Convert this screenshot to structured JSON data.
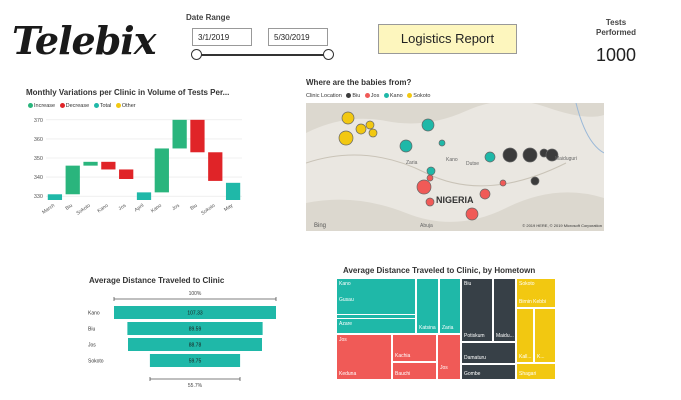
{
  "brand": {
    "logo_text": "Telebix"
  },
  "date_range": {
    "label": "Date Range",
    "start": "3/1/2019",
    "end": "5/30/2019"
  },
  "report_title": "Logistics Report",
  "kpi": {
    "label": "Tests Performed",
    "value": "1000"
  },
  "colors": {
    "increase": "#2ab57d",
    "decrease": "#e02428",
    "total": "#1fb8a8",
    "other": "#f2c811"
  },
  "waterfall": {
    "title": "Monthly Variations per Clinic in Volume of Tests Per...",
    "legend": [
      "Increase",
      "Decrease",
      "Total",
      "Other"
    ],
    "y_ticks": [
      "370",
      "360",
      "350",
      "340",
      "330"
    ]
  },
  "map": {
    "title": "Where are the babies from?",
    "legend_label": "Clinic Location",
    "legend_items": [
      "Biu",
      "Jos",
      "Kano",
      "Sokoto"
    ],
    "country_label": "NIGERIA",
    "attribution": "© 2019 HERE, © 2019 Microsoft Corporation",
    "bing": "Bing",
    "place_labels": [
      "Kano",
      "Dutse",
      "Maiduguri",
      "Abuja",
      "Zaria"
    ]
  },
  "funnel": {
    "title": "Average Distance Traveled to Clinic",
    "top_pct": "100%",
    "bottom_pct": "55.7%"
  },
  "treemap": {
    "title": "Average Distance Traveled to Clinic, by Hometown",
    "cells": {
      "kano_head": "Kano",
      "gusau": "Gusau",
      "azare": "Azare",
      "katsina": "Katsina",
      "zaria": "Zaria",
      "biu_head": "Biu",
      "potiskum": "Potiskum",
      "maidu": "Maidu...",
      "jos_head": "Jos",
      "kachia": "Kachia",
      "keduna": "Keduna",
      "bauchi": "Bauchi",
      "jos_small": "Jos",
      "damaturu": "Damaturu",
      "gombe": "Gombe",
      "sokoto_head": "Sokoto",
      "birnin": "Birnin Kebbi",
      "kall": "Kall...",
      "k": "K...",
      "shagari": "Shagari"
    }
  },
  "chart_data": [
    {
      "type": "bar",
      "subtype": "waterfall",
      "title": "Monthly Variations per Clinic in Volume of Tests Per...",
      "categories": [
        "March",
        "Biu",
        "Sokoto",
        "Kano",
        "Jos",
        "April",
        "Kano",
        "Jos",
        "Biu",
        "Sokoto",
        "May"
      ],
      "series": [
        {
          "name": "Increase",
          "values": [
            null,
            15,
            2,
            null,
            null,
            null,
            23,
            15,
            null,
            null,
            null
          ]
        },
        {
          "name": "Decrease",
          "values": [
            null,
            null,
            null,
            -4,
            -5,
            null,
            null,
            null,
            -17,
            -15,
            null
          ]
        },
        {
          "name": "Total",
          "values": [
            331,
            null,
            null,
            null,
            null,
            332,
            null,
            null,
            null,
            null,
            337
          ]
        }
      ],
      "ylim": [
        328,
        372
      ]
    },
    {
      "type": "bar",
      "subtype": "funnel",
      "title": "Average Distance Traveled to Clinic",
      "categories": [
        "Kano",
        "Biu",
        "Jos",
        "Sokoto"
      ],
      "values": [
        107.33,
        89.59,
        88.78,
        59.75
      ]
    },
    {
      "type": "scatter",
      "title": "Where are the babies from?",
      "series": [
        {
          "name": "Biu",
          "values": []
        },
        {
          "name": "Jos",
          "values": []
        },
        {
          "name": "Kano",
          "values": []
        },
        {
          "name": "Sokoto",
          "values": []
        }
      ]
    }
  ]
}
